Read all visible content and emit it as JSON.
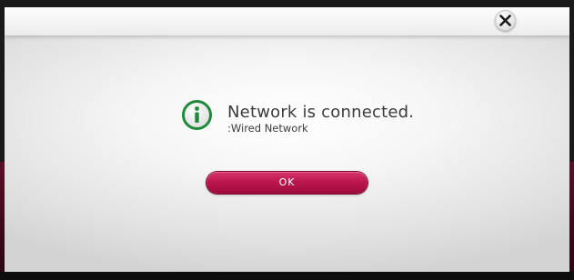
{
  "dialog": {
    "title": "Network is connected.",
    "subtitle": ":Wired Network",
    "ok_label": "OK",
    "close_icon": "close-icon",
    "status_icon": "info-icon"
  },
  "colors": {
    "accent": "#b9154c",
    "icon_green": "#1f8a3b"
  }
}
